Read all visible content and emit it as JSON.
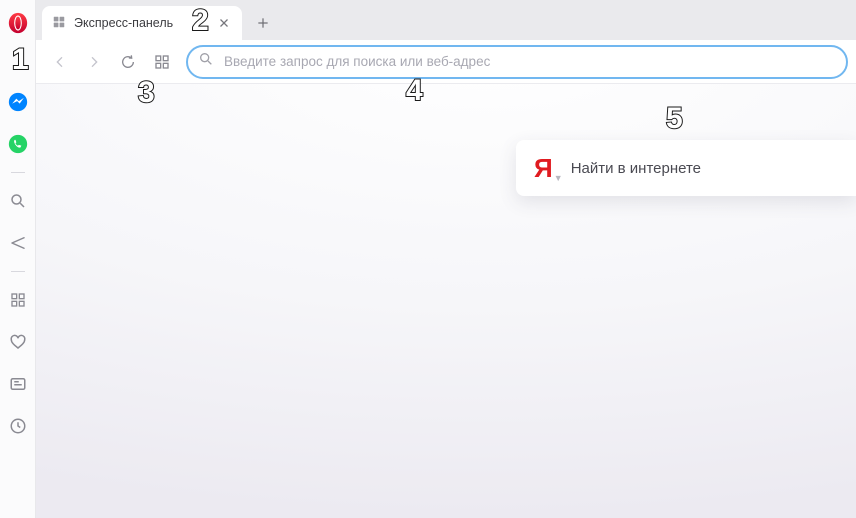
{
  "tab": {
    "title": "Экспресс-панель"
  },
  "addressbar": {
    "placeholder": "Введите запрос для поиска или веб-адрес",
    "value": ""
  },
  "speed_dial": {
    "search": {
      "provider_glyph": "Я",
      "placeholder": "Найти в интернете"
    }
  },
  "annotations": {
    "1": "1",
    "2": "2",
    "3": "3",
    "4": "4",
    "5": "5"
  }
}
